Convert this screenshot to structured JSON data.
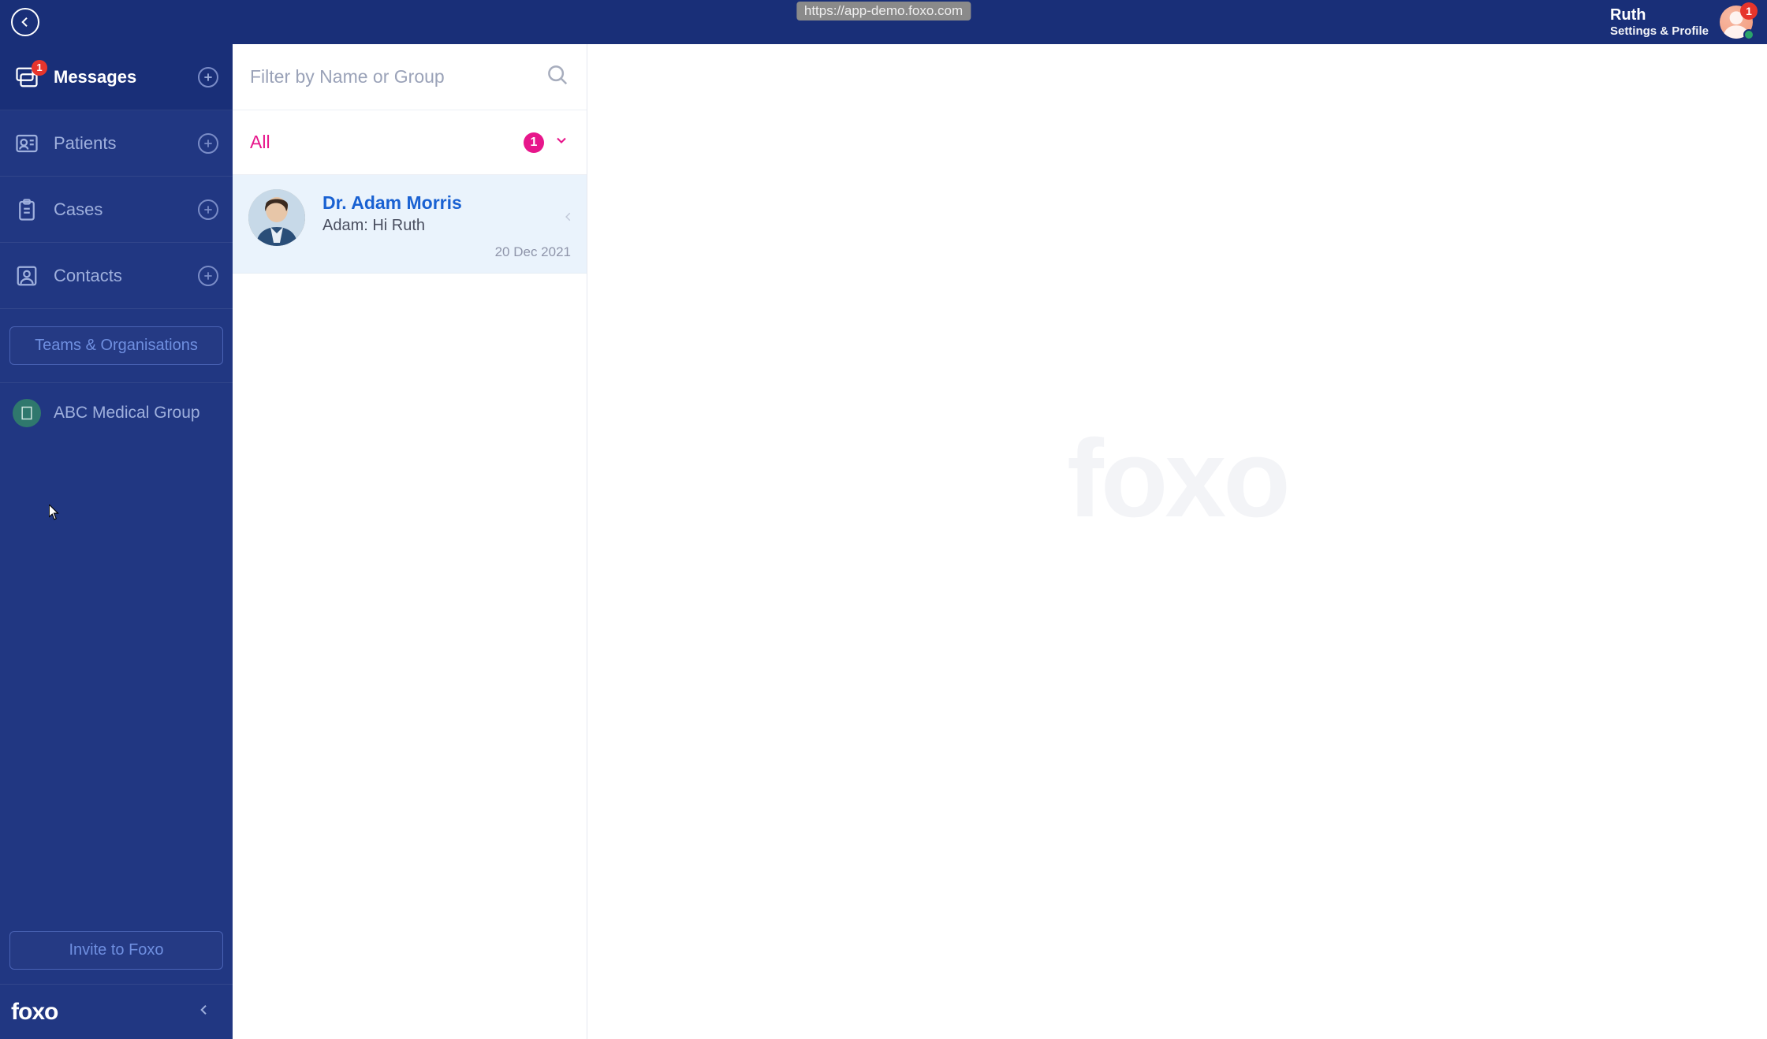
{
  "url": "https://app-demo.foxo.com",
  "user": {
    "name": "Ruth",
    "subtitle": "Settings & Profile",
    "badge": "1"
  },
  "sidebar": {
    "items": [
      {
        "label": "Messages",
        "badge": "1"
      },
      {
        "label": "Patients"
      },
      {
        "label": "Cases"
      },
      {
        "label": "Contacts"
      }
    ],
    "teams_button": "Teams & Organisations",
    "org": {
      "name": "ABC Medical Group"
    },
    "invite_button": "Invite to Foxo",
    "brand": "foxo"
  },
  "conversations": {
    "search_placeholder": "Filter by Name or Group",
    "filter_label": "All",
    "filter_count": "1",
    "items": [
      {
        "name": "Dr. Adam Morris",
        "preview": "Adam: Hi Ruth",
        "date": "20 Dec 2021"
      }
    ]
  },
  "watermark": "foxo"
}
